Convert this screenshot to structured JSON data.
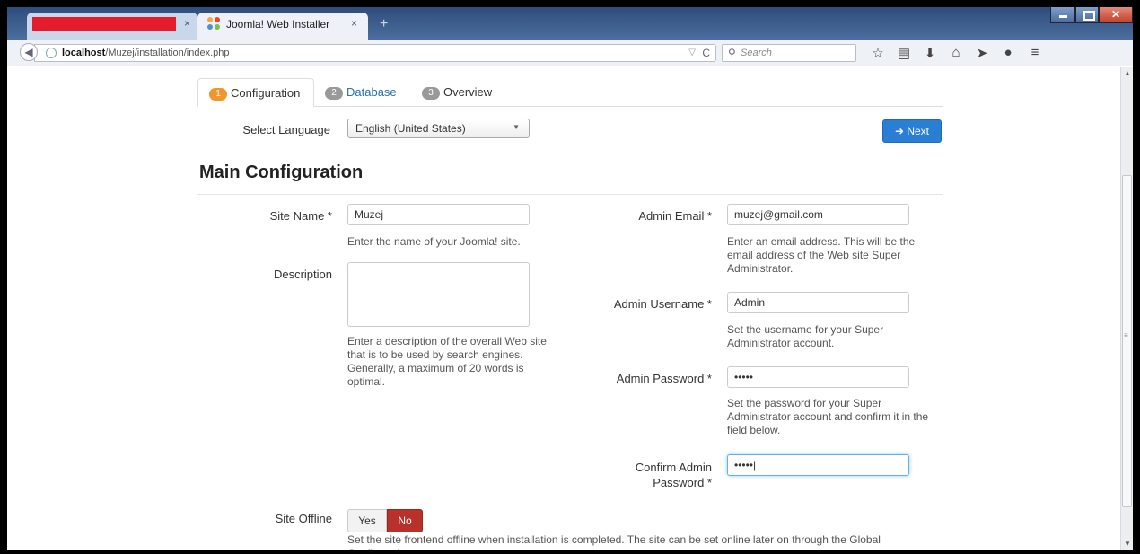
{
  "browser": {
    "tabs": [
      {
        "label": "",
        "close": "×"
      },
      {
        "label": "Joomla! Web Installer",
        "close": "×"
      }
    ],
    "new_tab": "+",
    "url_host": "localhost",
    "url_path": "/Muzej/installation/index.php",
    "search_placeholder": "Search",
    "toolbar_icons": [
      "star-icon",
      "reading-list-icon",
      "download-icon",
      "home-icon",
      "send-icon",
      "chat-icon",
      "menu-icon"
    ]
  },
  "steps": [
    {
      "num": "1",
      "label": "Configuration"
    },
    {
      "num": "2",
      "label": "Database"
    },
    {
      "num": "3",
      "label": "Overview"
    }
  ],
  "language": {
    "label": "Select Language",
    "value": "English (United States)"
  },
  "next_label": "Next",
  "main_title": "Main Configuration",
  "site_name": {
    "label": "Site Name *",
    "value": "Muzej",
    "help": "Enter the name of your Joomla! site."
  },
  "description": {
    "label": "Description",
    "value": "",
    "help": "Enter a description of the overall Web site that is to be used by search engines. Generally, a maximum of 20 words is optimal."
  },
  "admin_email": {
    "label": "Admin Email *",
    "value": "muzej@gmail.com",
    "help": "Enter an email address. This will be the email address of the Web site Super Administrator."
  },
  "admin_username": {
    "label": "Admin Username *",
    "value": "Admin",
    "help": "Set the username for your Super Administrator account."
  },
  "admin_password": {
    "label": "Admin Password *",
    "value": "•••••",
    "help": "Set the password for your Super Administrator account and confirm it in the field below."
  },
  "confirm_password": {
    "label_line1": "Confirm Admin",
    "label_line2": "Password *",
    "value": "•••••|"
  },
  "site_offline": {
    "label": "Site Offline",
    "yes": "Yes",
    "no": "No",
    "selected": "No",
    "help": "Set the site frontend offline when installation is completed. The site can be set online later on through the Global Configuration."
  },
  "colors": {
    "accent": "#2a7fd4",
    "step_active": "#f0962b",
    "offline_no": "#b9312b"
  }
}
